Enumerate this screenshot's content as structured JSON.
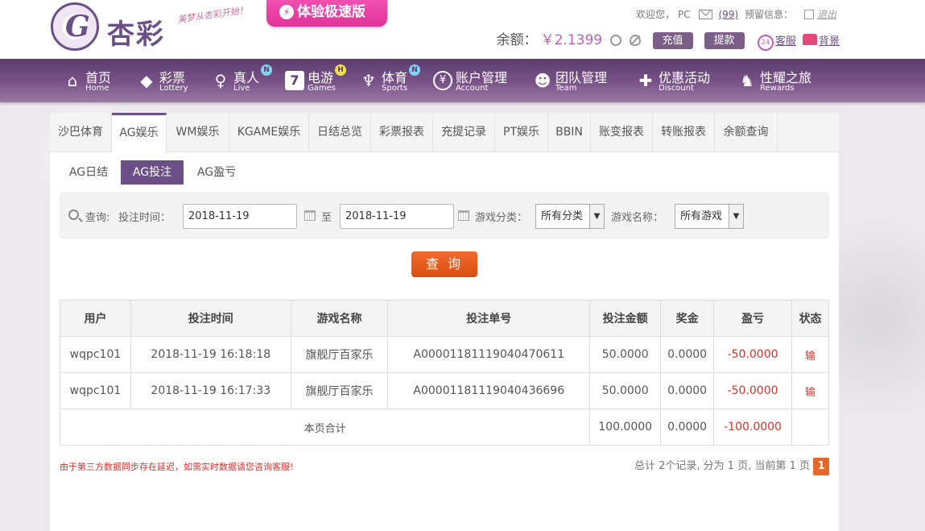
{
  "brand": {
    "logo_text": "杏彩",
    "slogan": "美梦从杏彩开始！",
    "speed_badge": "体验极速版"
  },
  "topbar": {
    "welcome": "欢迎您，",
    "username": "PC",
    "mail_count": "(99)",
    "notice_label": "预留信息：",
    "logout": "退出"
  },
  "balance": {
    "label": "余额：",
    "value": "￥2.1399",
    "deposit": "充值",
    "withdraw": "提款",
    "support": "客服",
    "background": "背景"
  },
  "nav": [
    {
      "cn": "首页",
      "en": "Home",
      "icon": "home-icon"
    },
    {
      "cn": "彩票",
      "en": "Lottery",
      "icon": "lottery-icon"
    },
    {
      "cn": "真人",
      "en": "Live",
      "icon": "live-icon",
      "badge": "N"
    },
    {
      "cn": "电游",
      "en": "Games",
      "icon": "games-icon",
      "badge": "H"
    },
    {
      "cn": "体育",
      "en": "Sports",
      "icon": "trophy-icon",
      "badge": "N"
    },
    {
      "cn": "账户管理",
      "en": "Account",
      "icon": "account-icon"
    },
    {
      "cn": "团队管理",
      "en": "Team",
      "icon": "team-icon"
    },
    {
      "cn": "优惠活动",
      "en": "Discount",
      "icon": "gift-icon"
    },
    {
      "cn": "性耀之旅",
      "en": "Rewards",
      "icon": "rewards-icon"
    }
  ],
  "tabs": [
    "沙巴体育",
    "AG娱乐",
    "WM娱乐",
    "KGAME娱乐",
    "日结总览",
    "彩票报表",
    "充提记录",
    "PT娱乐",
    "BBIN",
    "账变报表",
    "转账报表",
    "余额查询"
  ],
  "active_tab": "AG娱乐",
  "subtabs": [
    "AG日结",
    "AG投注",
    "AG盈亏"
  ],
  "active_subtab": "AG投注",
  "search": {
    "query_label": "查询:",
    "time_label": "投注时间：",
    "start_date": "2018-11-19",
    "to_label": "至",
    "end_date": "2018-11-19",
    "category_label": "游戏分类：",
    "category_value": "所有分类",
    "game_label": "游戏名称：",
    "game_value": "所有游戏",
    "button": "查 询"
  },
  "table": {
    "headers": [
      "用户",
      "投注时间",
      "游戏名称",
      "投注单号",
      "投注金额",
      "奖金",
      "盈亏",
      "状态"
    ],
    "rows": [
      [
        "wqpc101",
        "2018-11-19 16:18:18",
        "旗舰厅百家乐",
        "A00001181119040470611",
        "50.0000",
        "0.0000",
        "-50.0000",
        "输"
      ],
      [
        "wqpc101",
        "2018-11-19 16:17:33",
        "旗舰厅百家乐",
        "A00001181119040436696",
        "50.0000",
        "0.0000",
        "-50.0000",
        "输"
      ]
    ],
    "summary_label": "本页合计",
    "summary": [
      "100.0000",
      "0.0000",
      "-100.0000"
    ]
  },
  "notice": "由于第三方数据同步存在延迟，如需实时数据请您咨询客服!",
  "pager": {
    "text": "总计 2个记录, 分为 1 页, 当前第 1 页",
    "current": "1"
  }
}
